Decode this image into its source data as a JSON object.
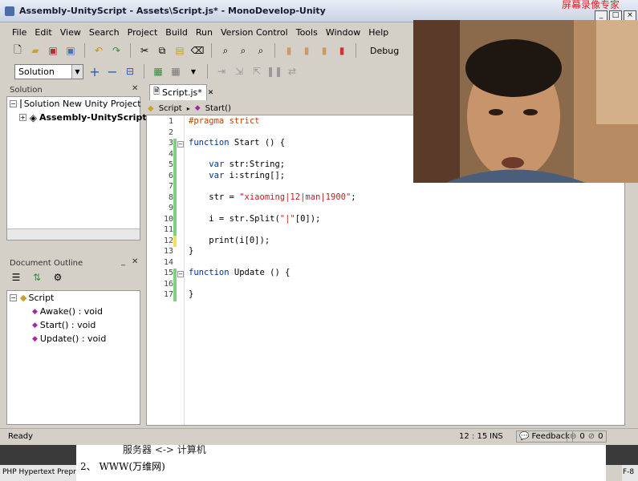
{
  "window": {
    "title": "Assembly-UnityScript - Assets\\Script.js* - MonoDevelop-Unity",
    "watermark": "屏幕录像专家"
  },
  "menu": [
    "File",
    "Edit",
    "View",
    "Search",
    "Project",
    "Build",
    "Run",
    "Version Control",
    "Tools",
    "Window",
    "Help"
  ],
  "toolbar": {
    "config_label": "Debug",
    "scope_combo": "Solution"
  },
  "solution_panel": {
    "title": "Solution",
    "root": "Solution New Unity Project",
    "project": "Assembly-UnityScript"
  },
  "outline_panel": {
    "title": "Document Outline",
    "root": "Script",
    "members": [
      "Awake() : void",
      "Start() : void",
      "Update() : void"
    ]
  },
  "editor": {
    "tab_label": "Script.js*",
    "breadcrumb_file": "Script",
    "breadcrumb_member": "Start()",
    "line_numbers": [
      "1",
      "2",
      "3",
      "4",
      "5",
      "6",
      "7",
      "8",
      "9",
      "10",
      "11",
      "12",
      "13",
      "14",
      "15",
      "16",
      "17"
    ]
  },
  "statusbar": {
    "ready": "Ready",
    "position": "12 : 15",
    "mode": "INS",
    "feedback": "Feedback",
    "errors": "0",
    "warnings": "0"
  },
  "background": {
    "line1": "服务器 <-> 计算机",
    "line2": "2、 WWW(万维网)",
    "taskbar_left": "PHP Hypertext Prepro",
    "taskbar_right": "F-8"
  }
}
